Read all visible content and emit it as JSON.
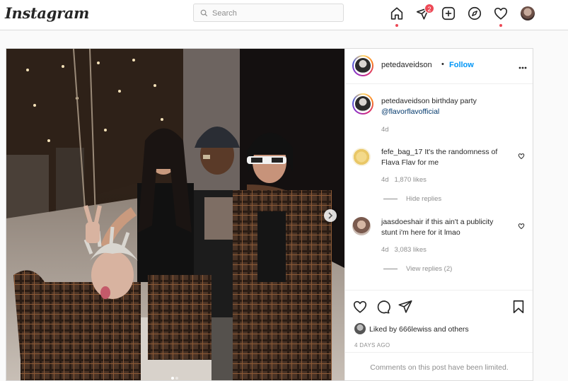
{
  "nav": {
    "logo": "Instagram",
    "search_placeholder": "Search",
    "direct_badge": "2",
    "icons": [
      "home-icon",
      "direct-icon",
      "new-post-icon",
      "explore-icon",
      "activity-heart-icon",
      "profile-avatar"
    ]
  },
  "post": {
    "author": "petedaveidson",
    "separator": "•",
    "follow_label": "Follow",
    "more_label": "•••",
    "caption": {
      "user": "petedaveidson",
      "text": " birthday party",
      "mention": "@flavorflavofficial",
      "age": "4d"
    },
    "comments": [
      {
        "user": "fefe_bag_17",
        "text_line1": " It's the randomness of",
        "text_line2": "Flava Flav for me",
        "age": "4d",
        "likes": "1,870 likes",
        "replies": "Hide replies"
      },
      {
        "user": "jaasdoeshair",
        "text_line1": " if this ain't a publicity",
        "text_line2": "stunt i'm here for it lmao",
        "age": "4d",
        "likes": "3,083 likes",
        "replies": "View replies (2)"
      }
    ],
    "liked_by_prefix": "Liked by ",
    "liked_by_user": "666lewiss",
    "liked_by_suffix": " and others",
    "date": "4 DAYS AGO",
    "comments_limited": "Comments on this post have been limited."
  },
  "colors": {
    "accent_blue": "#0095f6",
    "notification_red": "#ed4956",
    "border": "#dbdbdb",
    "muted_text": "#8e8e8e"
  }
}
